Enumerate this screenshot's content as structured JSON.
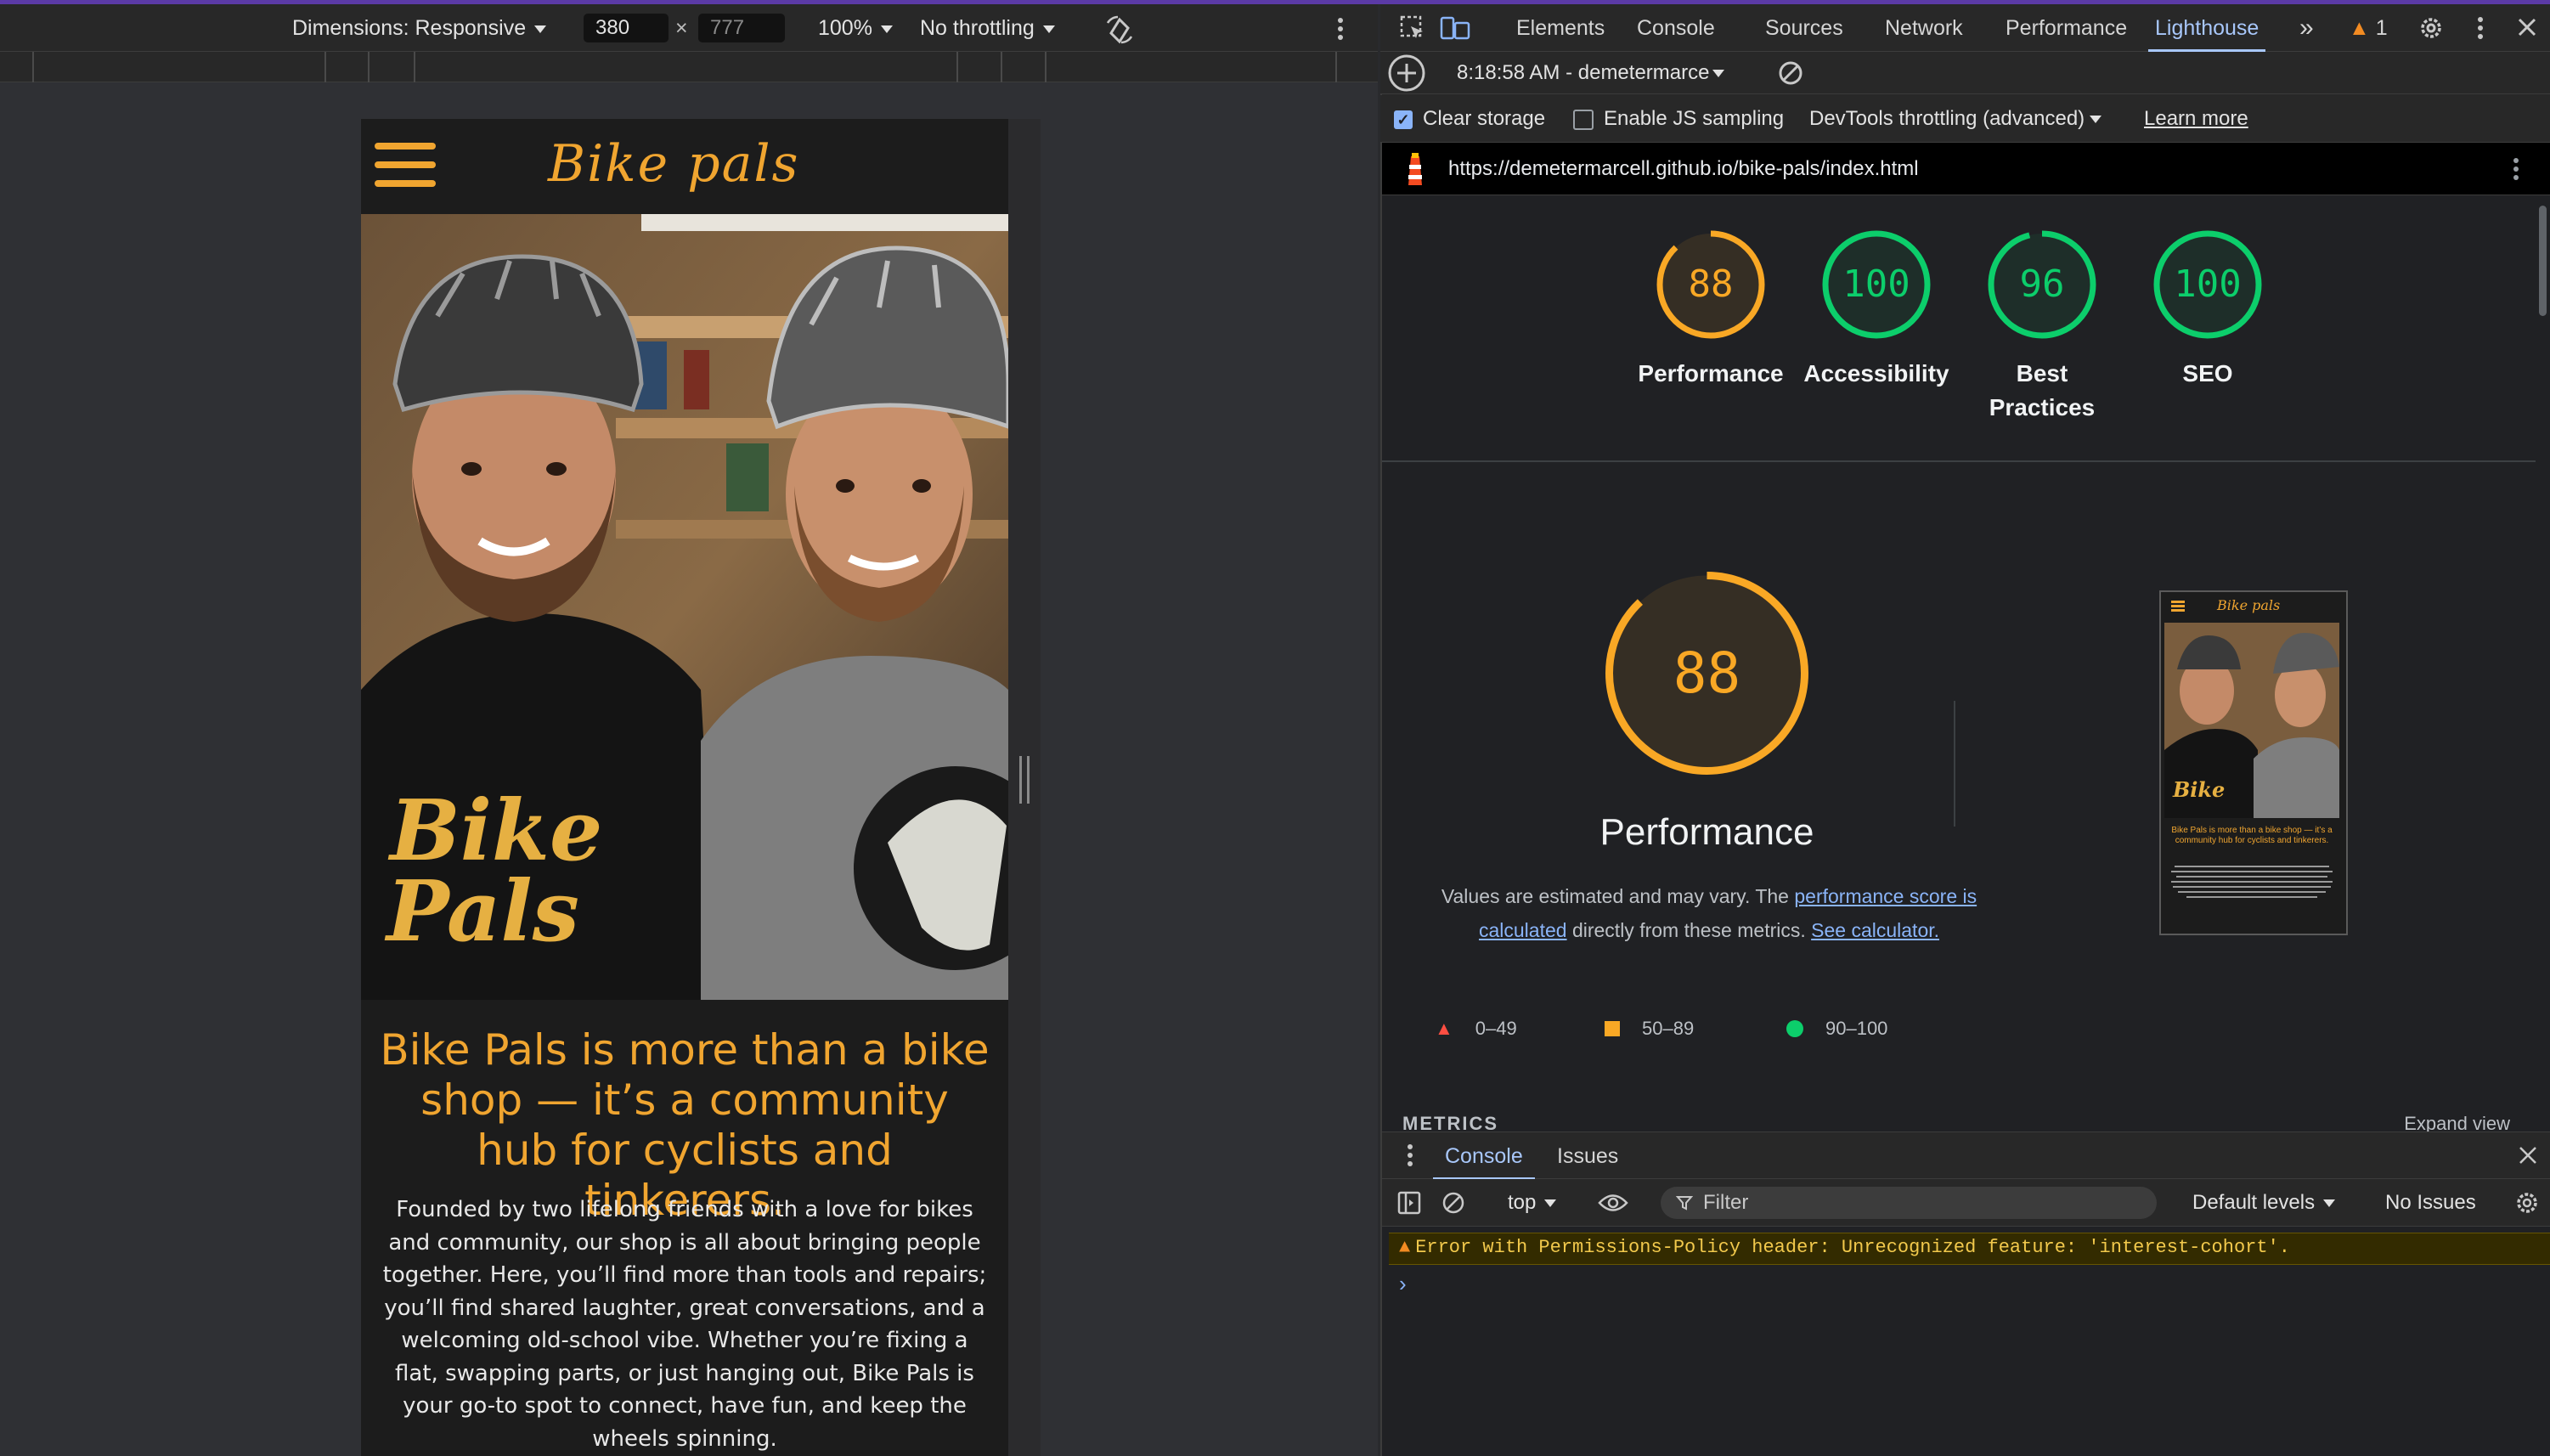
{
  "device_toolbar": {
    "dimensions_label": "Dimensions: Responsive",
    "width_value": "380",
    "times": "×",
    "height_placeholder": "777",
    "zoom": "100%",
    "throttling": "No throttling"
  },
  "site": {
    "logo": "Bike pals",
    "shirt_text_line1": "Bike",
    "shirt_text_line2": "Pals",
    "heading": "Bike Pals is more than a bike shop — it’s a community hub for cyclists and tinkerers.",
    "paragraph": "Founded by two lifelong friends with a love for bikes and community, our shop is all about bringing people together. Here, you’ll find more than tools and repairs; you’ll find shared laughter, great conversations, and a welcoming old-school vibe. Whether you’re fixing a flat, swapping parts, or just hanging out, Bike Pals is your go-to spot to connect, have fun, and keep the wheels spinning.",
    "thumb_heading": "Bike Pals is more than a bike shop — it’s a community hub for cyclists and tinkerers."
  },
  "devtools": {
    "tabs": [
      "Elements",
      "Console",
      "Sources",
      "Network",
      "Performance",
      "Lighthouse"
    ],
    "more_tabs": "»",
    "warning_count": "1",
    "report_selector": "8:18:58 AM - demetermarce",
    "options": {
      "clear_storage": "Clear storage",
      "js_sampling": "Enable JS sampling",
      "throttling": "DevTools throttling (advanced)",
      "learn_more": "Learn more"
    },
    "url": "https://demetermarcell.github.io/bike-pals/index.html"
  },
  "lighthouse": {
    "scores": [
      {
        "label": "Performance",
        "value": 88,
        "color": "#f9a825"
      },
      {
        "label": "Accessibility",
        "value": 100,
        "color": "#0cce6b"
      },
      {
        "label": "Best Practices",
        "value": 96,
        "color": "#0cce6b"
      },
      {
        "label": "SEO",
        "value": 100,
        "color": "#0cce6b"
      }
    ],
    "big_score": "88",
    "big_label": "Performance",
    "desc_prefix": "Values are estimated and may vary. The ",
    "desc_link1": "performance score is calculated",
    "desc_mid": " directly from these metrics. ",
    "desc_link2": "See calculator.",
    "legend": [
      "0–49",
      "50–89",
      "90–100"
    ],
    "metrics_label": "METRICS",
    "expand_label": "Expand view"
  },
  "drawer": {
    "tabs": [
      "Console",
      "Issues"
    ],
    "context": "top",
    "filter_placeholder": "Filter",
    "levels": "Default levels",
    "issues": "No Issues",
    "error_message": "Error with Permissions-Policy header: Unrecognized feature: 'interest-cohort'.",
    "prompt": "›"
  },
  "colors": {
    "accent_orange": "#f0a530",
    "lighthouse_green": "#0cce6b",
    "lighthouse_orange": "#f9a825",
    "lighthouse_red": "#ff4e42",
    "devtools_active_tab": "#a8c7fa"
  }
}
